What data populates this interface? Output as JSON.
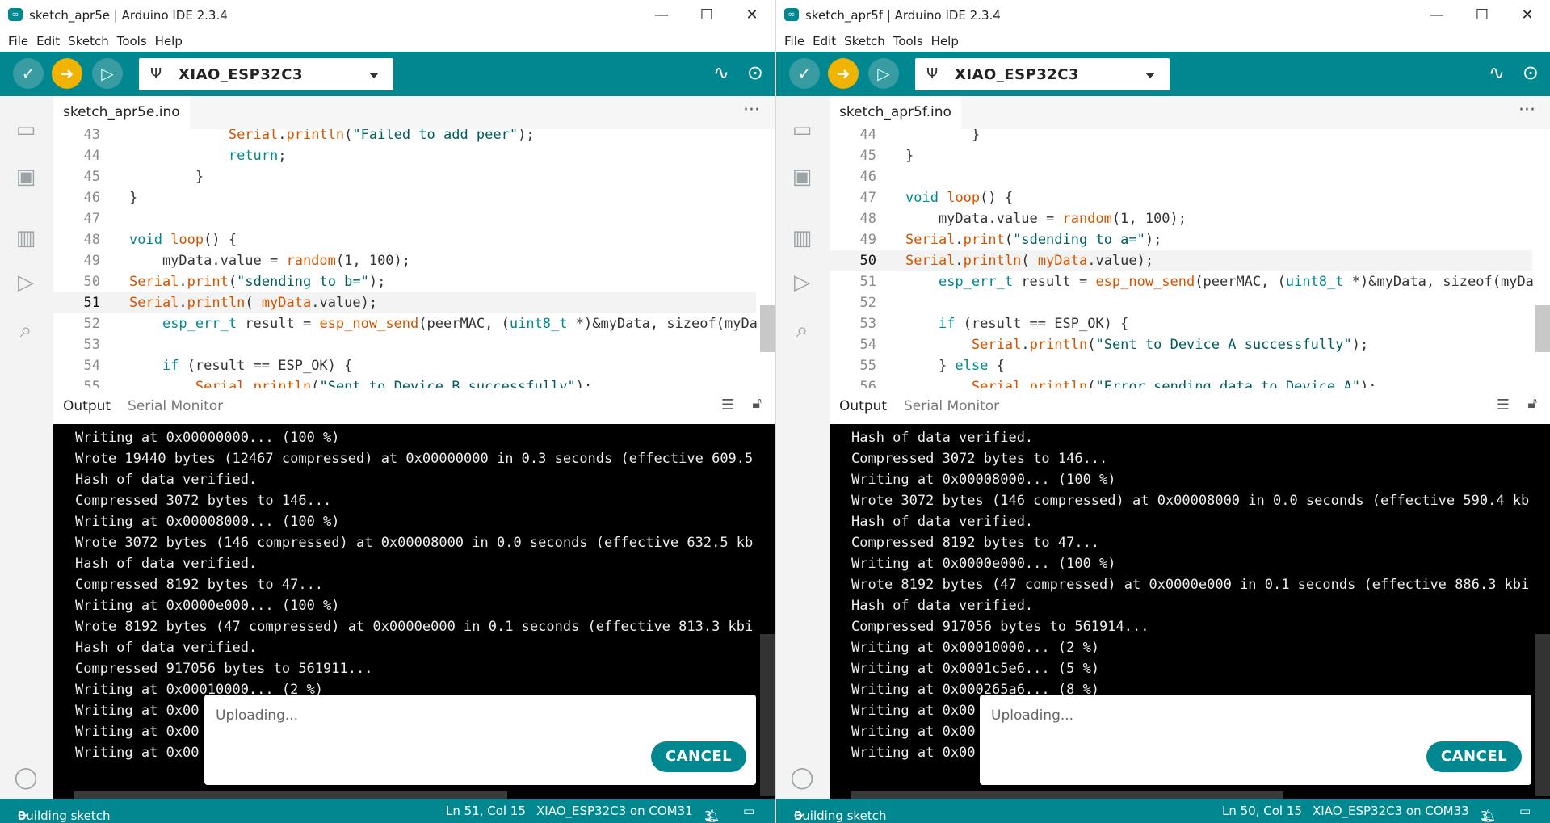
{
  "windows": [
    {
      "title": "sketch_apr5e | Arduino IDE 2.3.4",
      "menu": [
        "File",
        "Edit",
        "Sketch",
        "Tools",
        "Help"
      ],
      "board": "XIAO_ESP32C3",
      "tab": "sketch_apr5e.ino",
      "code_lines": [
        {
          "n": "43",
          "text": "            Serial.println(\"Failed to add peer\");"
        },
        {
          "n": "44",
          "text": "            return;"
        },
        {
          "n": "45",
          "text": "        }"
        },
        {
          "n": "46",
          "text": "}"
        },
        {
          "n": "47",
          "text": ""
        },
        {
          "n": "48",
          "text": "void loop() {"
        },
        {
          "n": "49",
          "text": "    myData.value = random(1, 100);"
        },
        {
          "n": "50",
          "text": "Serial.print(\"sdending to b=\");"
        },
        {
          "n": "51",
          "text": "Serial.println( myData.value);"
        },
        {
          "n": "52",
          "text": "    esp_err_t result = esp_now_send(peerMAC, (uint8_t *)&myData, sizeof(myDa"
        },
        {
          "n": "53",
          "text": ""
        },
        {
          "n": "54",
          "text": "    if (result == ESP_OK) {"
        },
        {
          "n": "55",
          "text": "        Serial.println(\"Sent to Device B successfully\");"
        }
      ],
      "current_line": "51",
      "output_tabs": [
        "Output",
        "Serial Monitor"
      ],
      "output_lines": [
        "Writing at 0x00000000... (100 %)",
        "Wrote 19440 bytes (12467 compressed) at 0x00000000 in 0.3 seconds (effective 609.5",
        "Hash of data verified.",
        "Compressed 3072 bytes to 146...",
        "Writing at 0x00008000... (100 %)",
        "Wrote 3072 bytes (146 compressed) at 0x00008000 in 0.0 seconds (effective 632.5 kb",
        "Hash of data verified.",
        "Compressed 8192 bytes to 47...",
        "Writing at 0x0000e000... (100 %)",
        "Wrote 8192 bytes (47 compressed) at 0x0000e000 in 0.1 seconds (effective 813.3 kbi",
        "Hash of data verified.",
        "Compressed 917056 bytes to 561911...",
        "Writing at 0x00010000... (2 %)",
        "Writing at 0x00",
        "Writing at 0x00",
        "Writing at 0x00"
      ],
      "toast": {
        "message": "Uploading...",
        "cancel": "CANCEL"
      },
      "status": {
        "left": "Building sketch",
        "pos": "Ln 51, Col 15",
        "board": "XIAO_ESP32C3 on COM31",
        "notifications": "3"
      }
    },
    {
      "title": "sketch_apr5f | Arduino IDE 2.3.4",
      "menu": [
        "File",
        "Edit",
        "Sketch",
        "Tools",
        "Help"
      ],
      "board": "XIAO_ESP32C3",
      "tab": "sketch_apr5f.ino",
      "code_lines": [
        {
          "n": "44",
          "text": "        }"
        },
        {
          "n": "45",
          "text": "}"
        },
        {
          "n": "46",
          "text": ""
        },
        {
          "n": "47",
          "text": "void loop() {"
        },
        {
          "n": "48",
          "text": "    myData.value = random(1, 100);"
        },
        {
          "n": "49",
          "text": "Serial.print(\"sdending to a=\");"
        },
        {
          "n": "50",
          "text": "Serial.println( myData.value);"
        },
        {
          "n": "51",
          "text": "    esp_err_t result = esp_now_send(peerMAC, (uint8_t *)&myData, sizeof(myDa"
        },
        {
          "n": "52",
          "text": ""
        },
        {
          "n": "53",
          "text": "    if (result == ESP_OK) {"
        },
        {
          "n": "54",
          "text": "        Serial.println(\"Sent to Device A successfully\");"
        },
        {
          "n": "55",
          "text": "    } else {"
        },
        {
          "n": "56",
          "text": "        Serial.println(\"Error sending data to Device A\");"
        }
      ],
      "current_line": "50",
      "output_tabs": [
        "Output",
        "Serial Monitor"
      ],
      "output_lines": [
        "Hash of data verified.",
        "Compressed 3072 bytes to 146...",
        "Writing at 0x00008000... (100 %)",
        "Wrote 3072 bytes (146 compressed) at 0x00008000 in 0.0 seconds (effective 590.4 kb",
        "Hash of data verified.",
        "Compressed 8192 bytes to 47...",
        "Writing at 0x0000e000... (100 %)",
        "Wrote 8192 bytes (47 compressed) at 0x0000e000 in 0.1 seconds (effective 886.3 kbi",
        "Hash of data verified.",
        "Compressed 917056 bytes to 561914...",
        "Writing at 0x00010000... (2 %)",
        "Writing at 0x0001c5e6... (5 %)",
        "Writing at 0x000265a6... (8 %)",
        "Writing at 0x00",
        "Writing at 0x00",
        "Writing at 0x00"
      ],
      "toast": {
        "message": "Uploading...",
        "cancel": "CANCEL"
      },
      "status": {
        "left": "Building sketch",
        "pos": "Ln 50, Col 15",
        "board": "XIAO_ESP32C3 on COM33",
        "notifications": "3"
      }
    }
  ],
  "icons": {
    "verify": "check-icon",
    "upload": "arrow-right-icon",
    "debug": "debug-icon",
    "usb": "usb-icon",
    "plotter": "serial-plotter-icon",
    "monitor": "serial-monitor-icon",
    "side": [
      "folder-icon",
      "board-manager-icon",
      "library-icon",
      "debug-sidebar-icon",
      "search-icon",
      "account-icon"
    ]
  },
  "colors": {
    "teal": "#00878f",
    "upload": "#f0b400"
  }
}
